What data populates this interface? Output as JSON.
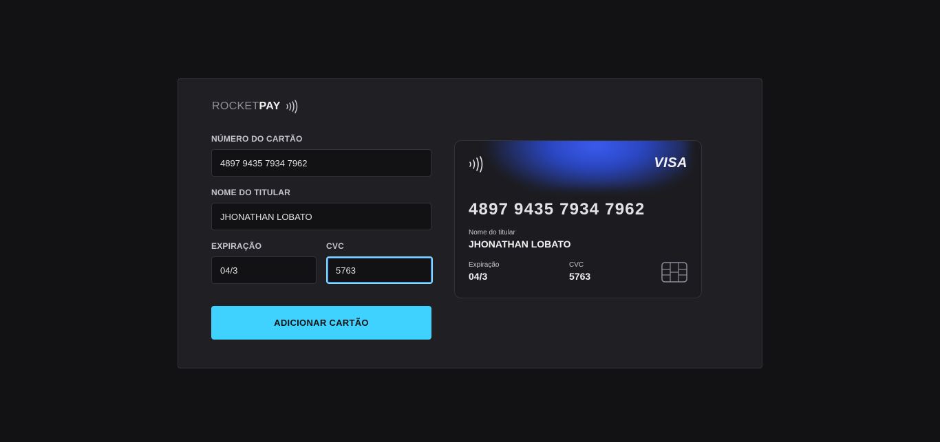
{
  "logo": {
    "rocket": "ROCKET",
    "pay": "PAY",
    "nfc_icon": "contactless-icon"
  },
  "form": {
    "card_number": {
      "label": "NÚMERO DO CARTÃO",
      "value": "4897 9435 7934 7962"
    },
    "holder": {
      "label": "NOME DO TITULAR",
      "value": "JHONATHAN LOBATO"
    },
    "expiration": {
      "label": "EXPIRAÇÃO",
      "value": "04/3"
    },
    "cvc": {
      "label": "CVC",
      "value": "5763"
    },
    "submit_label": "ADICIONAR CARTÃO"
  },
  "card_preview": {
    "brand": "VISA",
    "number": "4897 9435 7934 7962",
    "holder_label": "Nome do titular",
    "holder_value": "JHONATHAN LOBATO",
    "exp_label": "Expiração",
    "exp_value": "04/3",
    "cvc_label": "CVC",
    "cvc_value": "5763",
    "nfc_icon": "contactless-icon",
    "chip_icon": "card-chip-icon"
  },
  "colors": {
    "background": "#121214",
    "panel": "#202024",
    "accent": "#3fd2fe",
    "card_glow": "#3b5cf0"
  }
}
